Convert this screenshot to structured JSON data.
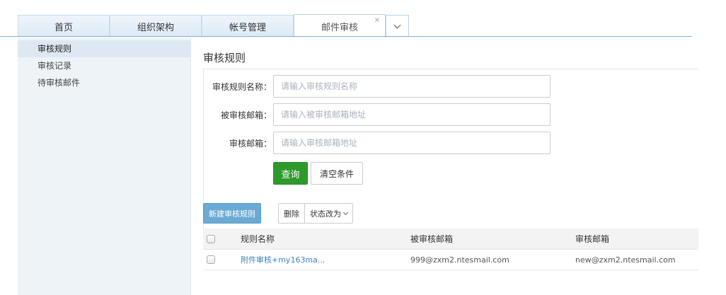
{
  "tabs": [
    {
      "label": "首页"
    },
    {
      "label": "组织架构"
    },
    {
      "label": "帐号管理"
    },
    {
      "label": "邮件审核",
      "close": "×"
    }
  ],
  "sidebar": {
    "items": [
      {
        "label": "审核规则"
      },
      {
        "label": "审核记录"
      },
      {
        "label": "待审核邮件"
      }
    ]
  },
  "main": {
    "title": "审核规则",
    "filters": [
      {
        "label": "审核规则名称：",
        "placeholder": "请输入审核规则名称",
        "value": ""
      },
      {
        "label": "被审核邮箱：",
        "placeholder": "请输入被审核邮箱地址",
        "value": ""
      },
      {
        "label": "审核邮箱：",
        "placeholder": "请输入审核邮箱地址",
        "value": ""
      }
    ],
    "search_label": "查询",
    "clear_label": "清空条件",
    "new_label": "新建审核规则",
    "delete_label": "删除",
    "status_label": "状态改为"
  },
  "table": {
    "headers": [
      "规则名称",
      "被审核邮箱",
      "审核邮箱"
    ],
    "rows": [
      {
        "name": "附件审核+my163ma...",
        "source": "999@zxm2.ntesmail.com",
        "auditor": "new@zxm2.ntesmail.com"
      }
    ]
  },
  "colors": {
    "primary_green": "#2f9a2c",
    "new_button_blue": "#6aaad4",
    "link_blue": "#3f7fbf",
    "sidebar_bg": "#eef3f8"
  },
  "icons": {
    "tab_more": "chevron-down-icon",
    "tab_close": "close-icon",
    "status_menu": "chevron-down-icon"
  }
}
